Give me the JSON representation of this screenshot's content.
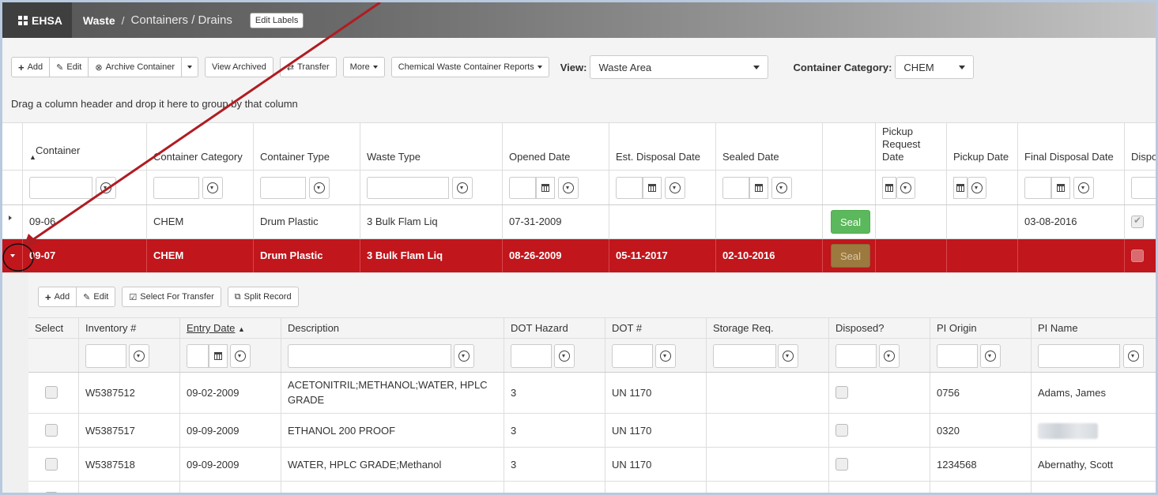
{
  "header": {
    "brand": "EHSA",
    "module": "Waste",
    "separator": "/",
    "page": "Containers / Drains",
    "edit_labels": "Edit Labels"
  },
  "toolbar": {
    "add": "Add",
    "edit": "Edit",
    "archive_container": "Archive Container",
    "view_archived": "View Archived",
    "transfer": "Transfer",
    "more": "More",
    "reports": "Chemical Waste Container Reports",
    "view_label": "View:",
    "view_value": "Waste Area",
    "category_label": "Container Category:",
    "category_value": "CHEM"
  },
  "group_hint": "Drag a column header and drop it here to group by that column",
  "columns": {
    "container": "Container",
    "container_category": "Container Category",
    "container_type": "Container Type",
    "waste_type": "Waste Type",
    "opened_date": "Opened Date",
    "est_disposal_date": "Est. Disposal Date",
    "sealed_date": "Sealed Date",
    "pickup_request_date": "Pickup Request Date",
    "pickup_date": "Pickup Date",
    "final_disposal_date": "Final Disposal Date",
    "disposed_truncated": "Dispos"
  },
  "rows": [
    {
      "container": "09-06",
      "category": "CHEM",
      "type": "Drum Plastic",
      "waste": "3 Bulk Flam Liq",
      "opened": "07-31-2009",
      "est_disposal": "",
      "sealed": "",
      "seal_label": "Seal",
      "pickup_request": "",
      "pickup": "",
      "final_disposal": "03-08-2016"
    },
    {
      "container": "09-07",
      "category": "CHEM",
      "type": "Drum Plastic",
      "waste": "3 Bulk Flam Liq",
      "opened": "08-26-2009",
      "est_disposal": "05-11-2017",
      "sealed": "02-10-2016",
      "seal_label": "Seal",
      "pickup_request": "",
      "pickup": "",
      "final_disposal": ""
    }
  ],
  "detail": {
    "toolbar": {
      "add": "Add",
      "edit": "Edit",
      "select_for_transfer": "Select For Transfer",
      "split_record": "Split Record"
    },
    "columns": {
      "select": "Select",
      "inventory": "Inventory #",
      "entry_date": "Entry Date",
      "description": "Description",
      "dot_hazard": "DOT Hazard",
      "dot_number": "DOT #",
      "storage_req": "Storage Req.",
      "disposed": "Disposed?",
      "pi_origin": "PI Origin",
      "pi_name": "PI Name"
    },
    "rows": [
      {
        "inventory": "W5387512",
        "entry_date": "09-02-2009",
        "description_line1": "ACETONITRIL;METHANOL;WATER, HPLC",
        "description_line2": "GRADE",
        "dot_hazard": "3",
        "dot_number": "UN 1170",
        "storage": "",
        "pi_origin": "0756",
        "pi_name": "Adams, James"
      },
      {
        "inventory": "W5387517",
        "entry_date": "09-09-2009",
        "description_line1": "ETHANOL 200 PROOF",
        "dot_hazard": "3",
        "dot_number": "UN 1170",
        "storage": "",
        "pi_origin": "0320",
        "pi_name": ""
      },
      {
        "inventory": "W5387518",
        "entry_date": "09-09-2009",
        "description_line1": "WATER, HPLC GRADE;Methanol",
        "dot_hazard": "3",
        "dot_number": "UN 1170",
        "storage": "",
        "pi_origin": "1234568",
        "pi_name": "Abernathy, Scott"
      }
    ]
  },
  "colors": {
    "selected_row": "#c0161c",
    "seal_green": "#5cb85c",
    "annotation": "#b01c22"
  }
}
